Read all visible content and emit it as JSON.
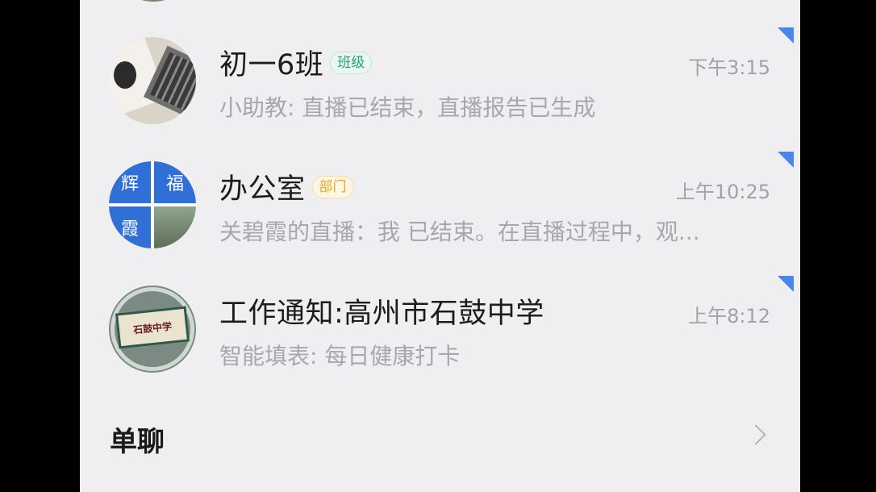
{
  "conversations": [
    {
      "title": "初一6班",
      "tag": "班级",
      "time": "下午3:15",
      "preview": "小助教: 直播已结束，直播报告已生成",
      "avatar_icon": "laptop-photo-avatar"
    },
    {
      "title": "办公室",
      "tag": "部门",
      "time": "上午10:25",
      "preview": "关碧霞的直播：我 已结束。在直播过程中，观...",
      "avatar_icon": "grid-name-avatar",
      "avatar_chars": [
        "辉",
        "福",
        "霞"
      ]
    },
    {
      "title": "工作通知:高州市石鼓中学",
      "tag": "",
      "time": "上午8:12",
      "preview": "智能填表: 每日健康打卡",
      "avatar_icon": "school-badge-avatar",
      "avatar_text": "石鼓中学"
    }
  ],
  "section": {
    "title": "单聊"
  },
  "colors": {
    "background": "#efeff1",
    "tag_green": "#2aa37a",
    "tag_yellow": "#e0a824",
    "corner_flag": "#4a86e8"
  }
}
